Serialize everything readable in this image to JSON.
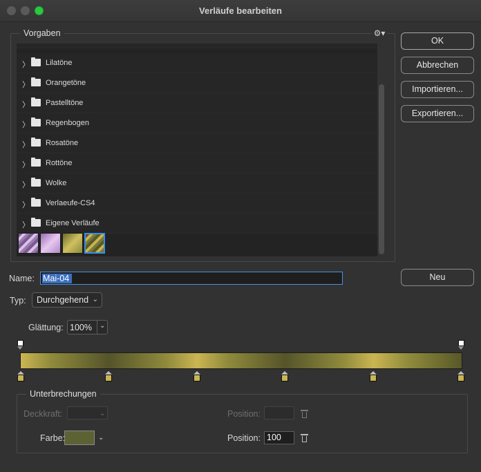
{
  "window": {
    "title": "Verläufe bearbeiten"
  },
  "presets": {
    "label": "Vorgaben",
    "folders": [
      {
        "label": ""
      },
      {
        "label": "Lilatöne"
      },
      {
        "label": "Orangetöne"
      },
      {
        "label": "Pastelltöne"
      },
      {
        "label": "Regenbogen"
      },
      {
        "label": "Rosatöne"
      },
      {
        "label": "Rottöne"
      },
      {
        "label": "Wolke"
      },
      {
        "label": "Verlaeufe-CS4"
      },
      {
        "label": "Eigene Verläufe"
      }
    ],
    "selected_swatch_index": 3
  },
  "buttons": {
    "ok": "OK",
    "cancel": "Abbrechen",
    "import": "Importieren...",
    "export": "Exportieren...",
    "new": "Neu"
  },
  "name": {
    "label": "Name:",
    "value": "Mai-04"
  },
  "type": {
    "label": "Typ:",
    "value": "Durchgehend"
  },
  "smoothing": {
    "label": "Glättung:",
    "value": "100%"
  },
  "gradient": {
    "colors": {
      "gold": "#cbb552",
      "olive": "#8f8a3c",
      "dark_olive": "#55542a",
      "end": "#585828"
    },
    "opacity_stops": [
      0,
      100
    ],
    "color_stops": [
      0,
      20,
      40,
      60,
      80,
      100
    ]
  },
  "stops": {
    "label": "Unterbrechungen",
    "opacity_label": "Deckkraft:",
    "opacity_position_label": "Position:",
    "color_label": "Farbe:",
    "color_value": "#5c6234",
    "color_position_label": "Position:",
    "color_position_value": "100"
  }
}
